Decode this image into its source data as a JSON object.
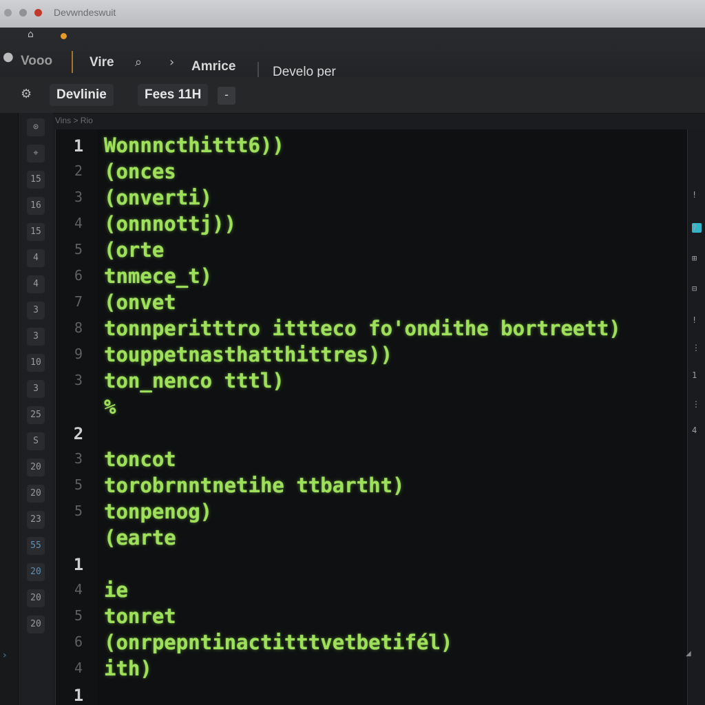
{
  "browser_tab": {
    "title": "Devwndeswuit"
  },
  "toolbar": {
    "item1": "Vooo",
    "item2": "Vire",
    "item3": "Amrice",
    "item4": "Develo per"
  },
  "subbar": {
    "project": "Devlinie",
    "files": "Fees 11H",
    "caret": "-"
  },
  "breadcrumb": "Vins > Rio",
  "activity_bar": [
    "⊙",
    "⌖",
    "15",
    "16",
    "15",
    "4",
    "4",
    "3",
    "3",
    "10",
    "3",
    "25",
    "S",
    "20",
    "20",
    "23",
    "55",
    "20",
    "20",
    "20"
  ],
  "line_numbers": [
    "1",
    "2",
    "3",
    "4",
    "5",
    "6",
    "7",
    "8",
    "9",
    "3",
    "",
    "2",
    "3",
    "5",
    "5",
    "",
    "1",
    "4",
    "5",
    "6",
    "4",
    "1"
  ],
  "code_lines": [
    "Wonnncthittt6))",
    "(onces",
    "(onverti)",
    "(onnnottj))",
    "(orte",
    "tnmece_t)",
    "(onvet",
    "tonnperitttro ittteco fo'ondithe bortreett)",
    "touppetnasthatthittres))",
    "ton_nenco tttl)",
    "%",
    "",
    "toncot",
    "torobrnntnetihe ttbartht)",
    "tonpenog)",
    "(earte",
    "",
    "ie",
    "tonret",
    "(onrpepntinactitttvetbetifél)",
    "ith)"
  ],
  "right_panel": [
    "!",
    "?",
    "⊞",
    "⊟",
    "!",
    "⋮",
    "1",
    "⋮",
    "4"
  ],
  "colors": {
    "code_green": "#9fe05a",
    "editor_bg": "#0f1012",
    "accent_orange": "#e39b2b",
    "accent_cyan": "#2fb4c9"
  }
}
